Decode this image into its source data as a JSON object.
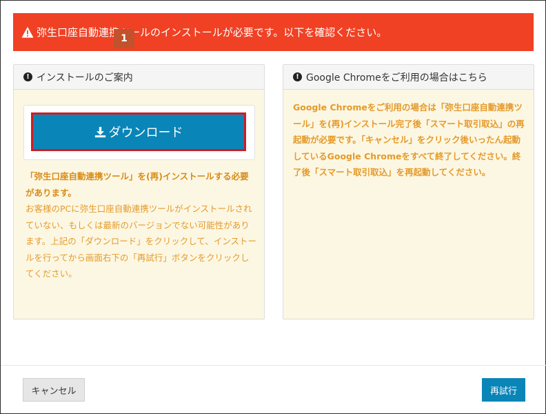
{
  "alert": {
    "icon": "warning-triangle-icon",
    "message": "弥生口座自動連携ツールのインストールが必要です。以下を確認ください。",
    "color": "#f04124"
  },
  "install_panel": {
    "title": "インストールのご案内",
    "step_badge": "1",
    "download_label": "ダウンロード",
    "note_bold": "「弥生口座自動連携ツール」を(再)インストールする必要があります。",
    "note_body": "お客様のPCに弥生口座自動連携ツールがインストールされていない、もしくは最新のバージョンでない可能性があります。上記の「ダウンロード」をクリックして、インストールを行ってから画面右下の「再試行」ボタンをクリックしてください。"
  },
  "chrome_panel": {
    "title": "Google Chromeをご利用の場合はこちら",
    "note": "Google Chromeをご利用の場合は「弥生口座自動連携ツール」を(再)インストール完了後「スマート取引取込」の再起動が必要です。「キャンセル」をクリック後いったん起動しているGoogle Chromeをすべて終了してください。終了後「スマート取引取込」を再起動してください。"
  },
  "footer": {
    "cancel_label": "キャンセル",
    "retry_label": "再試行"
  },
  "colors": {
    "primary": "#0a85b8",
    "panel_bg": "#fcf7e3",
    "note_text": "#e59a2a",
    "highlight_border": "#d21b22"
  }
}
